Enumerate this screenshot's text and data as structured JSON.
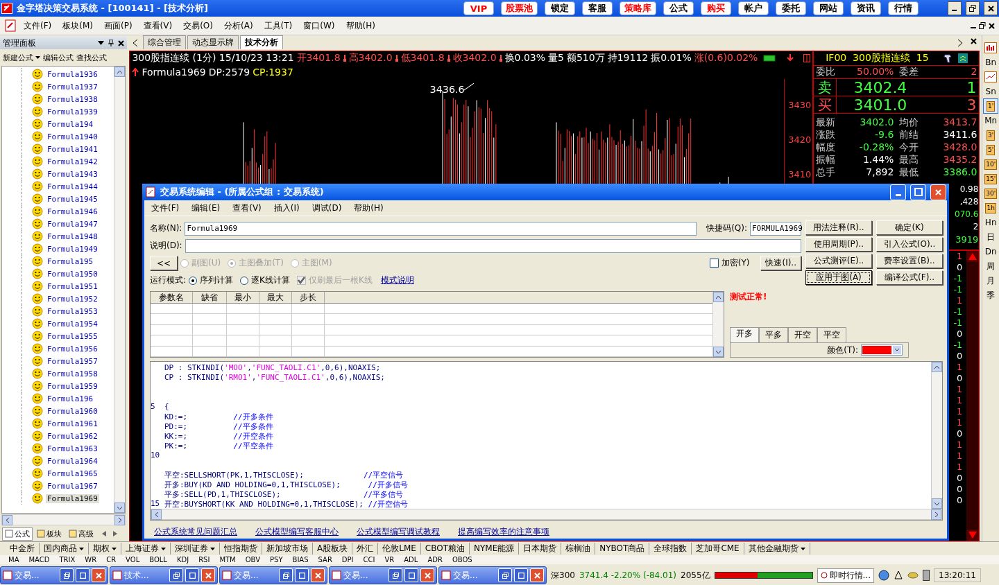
{
  "window": {
    "title": "金字塔决策交易系统 - [100141] - [技术分析]"
  },
  "title_buttons": [
    {
      "label": "VIP",
      "color": "#ff0000"
    },
    {
      "label": "股票池",
      "color": "#ff0000"
    },
    {
      "label": "锁定",
      "color": "#000000"
    },
    {
      "label": "客服",
      "color": "#000000"
    },
    {
      "label": "策略库",
      "color": "#ff0000"
    },
    {
      "label": "公式",
      "color": "#000000"
    },
    {
      "label": "购买",
      "color": "#ff0000"
    },
    {
      "label": "帐户",
      "color": "#000000"
    },
    {
      "label": "委托",
      "color": "#000000"
    },
    {
      "label": "网站",
      "color": "#000000"
    },
    {
      "label": "资讯",
      "color": "#000000"
    },
    {
      "label": "行情",
      "color": "#000000"
    }
  ],
  "menu": [
    "文件(F)",
    "板块(M)",
    "画面(P)",
    "查看(V)",
    "交易(O)",
    "分析(A)",
    "工具(T)",
    "窗口(W)",
    "帮助(H)"
  ],
  "left_panel": {
    "title": "管理面板",
    "toolbar": [
      {
        "label": "新建公式",
        "dropdown": true
      },
      {
        "label": "编辑公式",
        "dropdown": false
      },
      {
        "label": "查找公式",
        "dropdown": false
      }
    ],
    "items": [
      {
        "label": "Formula1936",
        "selected": false
      },
      {
        "label": "Formula1937",
        "selected": false
      },
      {
        "label": "Formula1938",
        "selected": false
      },
      {
        "label": "Formula1939",
        "selected": false
      },
      {
        "label": "Formula194",
        "selected": false
      },
      {
        "label": "Formula1940",
        "selected": false
      },
      {
        "label": "Formula1941",
        "selected": false
      },
      {
        "label": "Formula1942",
        "selected": false
      },
      {
        "label": "Formula1943",
        "selected": false
      },
      {
        "label": "Formula1944",
        "selected": false
      },
      {
        "label": "Formula1945",
        "selected": false
      },
      {
        "label": "Formula1946",
        "selected": false
      },
      {
        "label": "Formula1947",
        "selected": false
      },
      {
        "label": "Formula1948",
        "selected": false
      },
      {
        "label": "Formula1949",
        "selected": false
      },
      {
        "label": "Formula195",
        "selected": false
      },
      {
        "label": "Formula1950",
        "selected": false
      },
      {
        "label": "Formula1951",
        "selected": false
      },
      {
        "label": "Formula1952",
        "selected": false
      },
      {
        "label": "Formula1953",
        "selected": false
      },
      {
        "label": "Formula1954",
        "selected": false
      },
      {
        "label": "Formula1955",
        "selected": false
      },
      {
        "label": "Formula1956",
        "selected": false
      },
      {
        "label": "Formula1957",
        "selected": false
      },
      {
        "label": "Formula1958",
        "selected": false
      },
      {
        "label": "Formula1959",
        "selected": false
      },
      {
        "label": "Formula196",
        "selected": false
      },
      {
        "label": "Formula1960",
        "selected": false
      },
      {
        "label": "Formula1961",
        "selected": false
      },
      {
        "label": "Formula1962",
        "selected": false
      },
      {
        "label": "Formula1963",
        "selected": false
      },
      {
        "label": "Formula1964",
        "selected": false
      },
      {
        "label": "Formula1965",
        "selected": false
      },
      {
        "label": "Formula1967",
        "selected": false
      },
      {
        "label": "Formula1969",
        "selected": true
      }
    ],
    "tabs": [
      {
        "label": "公式",
        "selected": true
      },
      {
        "label": "板块",
        "selected": false
      },
      {
        "label": "高级",
        "selected": false
      }
    ]
  },
  "view_tabs": [
    {
      "label": "综合管理",
      "selected": false
    },
    {
      "label": "动态显示牌",
      "selected": false
    },
    {
      "label": "技术分析",
      "selected": true
    }
  ],
  "chart": {
    "header": [
      {
        "kind": "plain",
        "text": "300股指连续 (1分) 15/10/23 13:21",
        "color": "#ffffff"
      },
      {
        "kind": "price",
        "text": "开3401.8",
        "color": "#ff5050"
      },
      {
        "kind": "price",
        "text": "高3402.0",
        "color": "#ff5050"
      },
      {
        "kind": "price",
        "text": "低3401.8",
        "color": "#ff5050"
      },
      {
        "kind": "price",
        "text": "收3402.0",
        "color": "#ff5050"
      },
      {
        "kind": "plain",
        "text": "换0.03%",
        "color": "#ffffff"
      },
      {
        "kind": "plain",
        "text": "量5",
        "color": "#ffffff"
      },
      {
        "kind": "plain",
        "text": "额510万",
        "color": "#ffffff"
      },
      {
        "kind": "plain",
        "text": "持19112",
        "color": "#ffffff"
      },
      {
        "kind": "plain",
        "text": "振0.01%",
        "color": "#ffffff"
      },
      {
        "kind": "plain",
        "text": "涨(0.6)0.02%",
        "color": "#ff5050"
      }
    ],
    "formula_line": [
      {
        "text": "Formula1969",
        "color": "#ffffff"
      },
      {
        "text": "DP:2579",
        "color": "#ffffff"
      },
      {
        "text": "CP:1937",
        "color": "#ffff00"
      }
    ],
    "peak_label": "3436.6",
    "axis_labels": [
      "3430",
      "3420",
      "3410"
    ]
  },
  "quote": {
    "title": "IF00  300股指连续  15",
    "ratio": [
      {
        "label": "委比",
        "value": "50.00%",
        "color": "#ff5050"
      },
      {
        "label": "委差",
        "value": "2",
        "color": "#ff5050"
      }
    ],
    "sell": {
      "label": "卖",
      "price": "3402.4",
      "qty": "1",
      "color": "#40ff40"
    },
    "buy": {
      "label": "买",
      "price": "3401.0",
      "qty": "3",
      "color": "#ff5050"
    },
    "rows": [
      [
        {
          "label": "最新",
          "value": "3402.0",
          "color": "#40ff40"
        },
        {
          "label": "均价",
          "value": "3413.7",
          "color": "#ff5050"
        }
      ],
      [
        {
          "label": "涨跌",
          "value": "-9.6",
          "color": "#40ff40"
        },
        {
          "label": "前结",
          "value": "3411.6",
          "color": "#ffffff"
        }
      ],
      [
        {
          "label": "幅度",
          "value": "-0.28%",
          "color": "#40ff40"
        },
        {
          "label": "今开",
          "value": "3428.0",
          "color": "#ff5050"
        }
      ],
      [
        {
          "label": "振幅",
          "value": "1.44%",
          "color": "#ffffff"
        },
        {
          "label": "最高",
          "value": "3435.2",
          "color": "#ff5050"
        }
      ],
      [
        {
          "label": "总手",
          "value": "7,892",
          "color": "#ffffff"
        },
        {
          "label": "最低",
          "value": "3386.0",
          "color": "#40ff40"
        }
      ]
    ],
    "fragments": [
      {
        "text": "0.98",
        "color": "#ffffff"
      },
      {
        "text": ",428",
        "color": "#ffffff"
      },
      {
        "text": "070.6",
        "color": "#40ff40"
      },
      {
        "text": "2",
        "color": "#ffffff"
      },
      {
        "text": "3919",
        "color": "#40ff40"
      }
    ],
    "ticks": [
      {
        "text": "1",
        "color": "#ff5050"
      },
      {
        "text": "0",
        "color": "#ffffff"
      },
      {
        "text": "-1",
        "color": "#40ff40"
      },
      {
        "text": "-1",
        "color": "#40ff40"
      },
      {
        "text": "1",
        "color": "#ff5050"
      },
      {
        "text": "-1",
        "color": "#40ff40"
      },
      {
        "text": "-1",
        "color": "#40ff40"
      },
      {
        "text": "0",
        "color": "#ffffff"
      },
      {
        "text": "-1",
        "color": "#40ff40"
      },
      {
        "text": "0",
        "color": "#ffffff"
      },
      {
        "text": "1",
        "color": "#ff5050"
      },
      {
        "text": "0",
        "color": "#ffffff"
      },
      {
        "text": "1",
        "color": "#ff5050"
      },
      {
        "text": "1",
        "color": "#ff5050"
      },
      {
        "text": "1",
        "color": "#ff5050"
      },
      {
        "text": "1",
        "color": "#ff5050"
      },
      {
        "text": "0",
        "color": "#ffffff"
      },
      {
        "text": "1",
        "color": "#ff5050"
      },
      {
        "text": "1",
        "color": "#ff5050"
      },
      {
        "text": "1",
        "color": "#ff5050"
      },
      {
        "text": "0",
        "color": "#ffffff"
      },
      {
        "text": "0",
        "color": "#ffffff"
      },
      {
        "text": "0",
        "color": "#ffffff"
      }
    ]
  },
  "right_toolbar": [
    {
      "kind": "bar_chart",
      "selected": false
    },
    {
      "kind": "text",
      "label": "Bn",
      "selected": false
    },
    {
      "kind": "line_chart",
      "selected": false
    },
    {
      "kind": "text",
      "label": "Sn",
      "selected": false
    },
    {
      "kind": "boxed",
      "label": "1'",
      "selected": true
    },
    {
      "kind": "text",
      "label": "Mn",
      "selected": false
    },
    {
      "kind": "boxed",
      "label": "3'",
      "selected": false
    },
    {
      "kind": "boxed",
      "label": "5'",
      "selected": false
    },
    {
      "kind": "boxed",
      "label": "10'",
      "selected": false
    },
    {
      "kind": "boxed",
      "label": "15'",
      "selected": false
    },
    {
      "kind": "boxed",
      "label": "30'",
      "selected": false
    },
    {
      "kind": "boxed",
      "label": "1h",
      "selected": false
    },
    {
      "kind": "text",
      "label": "Hn",
      "selected": false
    },
    {
      "kind": "text",
      "label": "日",
      "selected": false
    },
    {
      "kind": "text",
      "label": "Dn",
      "selected": false
    },
    {
      "kind": "text",
      "label": "周",
      "selected": false
    },
    {
      "kind": "text",
      "label": "月",
      "selected": false
    },
    {
      "kind": "text",
      "label": "季",
      "selected": false
    }
  ],
  "dialog": {
    "title": "交易系统编辑 - (所属公式组 : 交易系统)",
    "menu": [
      "文件(F)",
      "编辑(E)",
      "查看(V)",
      "插入(I)",
      "调试(D)",
      "帮助(H)"
    ],
    "name": {
      "label": "名称(N):",
      "value": "Formula1969"
    },
    "shortcut": {
      "label": "快捷码(Q):",
      "value": "FORMULA1969"
    },
    "description": {
      "label": "说明(D):"
    },
    "collapse_button": "<<",
    "chart_type": [
      {
        "label": "副图(U)",
        "selected": false,
        "disabled": true
      },
      {
        "label": "主图叠加(T)",
        "selected": true,
        "disabled": true
      },
      {
        "label": "主图(M)",
        "selected": false,
        "disabled": true
      }
    ],
    "encrypt": {
      "label": "加密(Y)",
      "checked": false
    },
    "quick_button": "快速(I)..",
    "run_mode": {
      "label": "运行模式:",
      "options": [
        {
          "label": "序列计算",
          "selected": true
        },
        {
          "label": "逐K线计算",
          "selected": false
        }
      ],
      "refresh_last": {
        "label": "仅刷最后一根K线",
        "checked": true,
        "disabled": true
      },
      "link": "模式说明"
    },
    "buttons": [
      {
        "label": "用法注释(R)..",
        "focused": false
      },
      {
        "label": "确定(K)",
        "focused": false
      },
      {
        "label": "使用周期(P)..",
        "focused": false
      },
      {
        "label": "引入公式(O)..",
        "focused": false
      },
      {
        "label": "公式测评(E)..",
        "focused": false
      },
      {
        "label": "费率设置(B)..",
        "focused": false
      },
      {
        "label": "应用于图(A)",
        "focused": true
      },
      {
        "label": "编译公式(F)..",
        "focused": false
      }
    ],
    "param_columns": [
      "参数名",
      "缺省",
      "最小",
      "最大",
      "步长"
    ],
    "status": "测试正常!",
    "signal_tabs": [
      {
        "label": "开多",
        "selected": true
      },
      {
        "label": "平多",
        "selected": false
      },
      {
        "label": "开空",
        "selected": false
      },
      {
        "label": "平空",
        "selected": false
      }
    ],
    "color_field": {
      "label": "颜色(T):",
      "color": "#ff0000"
    },
    "code": [
      {
        "kind": "code",
        "segments": [
          {
            "kind": "code",
            "text": "DP : STKINDI("
          },
          {
            "kind": "string",
            "text": "'MOO'"
          },
          {
            "kind": "code",
            "text": ","
          },
          {
            "kind": "string",
            "text": "'FUNC_TAOLI.C1'"
          },
          {
            "kind": "code",
            "text": ",0,6),NOAXIS;"
          }
        ]
      },
      {
        "kind": "code",
        "segments": [
          {
            "kind": "code",
            "text": "CP : STKINDI("
          },
          {
            "kind": "string",
            "text": "'RMO1'"
          },
          {
            "kind": "code",
            "text": ","
          },
          {
            "kind": "string",
            "text": "'FUNC_TAOLI.C1'"
          },
          {
            "kind": "code",
            "text": ",0,6),NOAXIS;"
          }
        ]
      },
      {
        "kind": "blank"
      },
      {
        "kind": "blank"
      },
      {
        "kind": "code",
        "number": "5",
        "segments": [
          {
            "kind": "code",
            "text": "{"
          }
        ]
      },
      {
        "kind": "code",
        "segments": [
          {
            "kind": "code",
            "text": "KD:=;          "
          },
          {
            "kind": "comment",
            "text": "//开多条件"
          }
        ]
      },
      {
        "kind": "code",
        "segments": [
          {
            "kind": "code",
            "text": "PD:=;          "
          },
          {
            "kind": "comment",
            "text": "//平多条件"
          }
        ]
      },
      {
        "kind": "code",
        "segments": [
          {
            "kind": "code",
            "text": "KK:=;          "
          },
          {
            "kind": "comment",
            "text": "//开空条件"
          }
        ]
      },
      {
        "kind": "code",
        "segments": [
          {
            "kind": "code",
            "text": "PK:=;          "
          },
          {
            "kind": "comment",
            "text": "//平空条件"
          }
        ]
      },
      {
        "kind": "blank",
        "number": "10"
      },
      {
        "kind": "blank"
      },
      {
        "kind": "code",
        "segments": [
          {
            "kind": "code",
            "text": "平空:SELLSHORT(PK,1,THISCLOSE);             "
          },
          {
            "kind": "comment",
            "text": "//平空信号"
          }
        ]
      },
      {
        "kind": "code",
        "segments": [
          {
            "kind": "code",
            "text": "开多:BUY(KD AND HOLDING=0,1,THISCLOSE);      "
          },
          {
            "kind": "comment",
            "text": "//开多信号"
          }
        ]
      },
      {
        "kind": "code",
        "segments": [
          {
            "kind": "code",
            "text": "平多:SELL(PD,1,THISCLOSE);                  "
          },
          {
            "kind": "comment",
            "text": "//平多信号"
          }
        ]
      },
      {
        "kind": "code",
        "number": "15",
        "segments": [
          {
            "kind": "code",
            "text": "开空:BUYSHORT(KK AND HOLDING=0,1,THISCLOSE); "
          },
          {
            "kind": "comment",
            "text": "//开空信号"
          }
        ]
      }
    ],
    "links": [
      "公式系统常见问题汇总",
      "公式模型编写客服中心",
      "公式模型编写调试教程",
      "提高编写效率的注意事项"
    ]
  },
  "market_tabs": [
    {
      "label": "中金所",
      "dropdown": false
    },
    {
      "label": "国内商品",
      "dropdown": true
    },
    {
      "label": "期权",
      "dropdown": true
    },
    {
      "label": "上海证券",
      "dropdown": true
    },
    {
      "label": "深圳证券",
      "dropdown": true
    },
    {
      "label": "恒指期货",
      "dropdown": false
    },
    {
      "label": "新加坡市场",
      "dropdown": false
    },
    {
      "label": "A股板块",
      "dropdown": false
    },
    {
      "label": "外汇",
      "dropdown": false
    },
    {
      "label": "伦敦LME",
      "dropdown": false
    },
    {
      "label": "CBOT粮油",
      "dropdown": false
    },
    {
      "label": "NYME能源",
      "dropdown": false
    },
    {
      "label": "日本期货",
      "dropdown": false
    },
    {
      "label": "棕榈油",
      "dropdown": false
    },
    {
      "label": "NYBOT商品",
      "dropdown": false
    },
    {
      "label": "全球指数",
      "dropdown": false
    },
    {
      "label": "芝加哥CME",
      "dropdown": false
    },
    {
      "label": "其他金融期货",
      "dropdown": true
    }
  ],
  "indicator_tabs": [
    "MA",
    "MACD",
    "TRIX",
    "WR",
    "CR",
    "VOL",
    "BOLL",
    "KDJ",
    "RSI",
    "MTM",
    "OBV",
    "PSY",
    "BIAS",
    "SAR",
    "DPI",
    "CCI",
    "VR",
    "ADL",
    "ADR",
    "OBOS"
  ],
  "taskbar": {
    "windows": [
      "交易...",
      "技术...",
      "交易...",
      "交易...",
      "交易..."
    ],
    "index": [
      {
        "text": "深300",
        "color": "#000000"
      },
      {
        "text": "3741.4 -2.20% (-84.01)",
        "color": "#008000"
      },
      {
        "text": "2055亿",
        "color": "#000000"
      }
    ],
    "breadth": {
      "level": 0.44
    },
    "quote_button": "即时行情...",
    "clock": "13:20:11"
  }
}
